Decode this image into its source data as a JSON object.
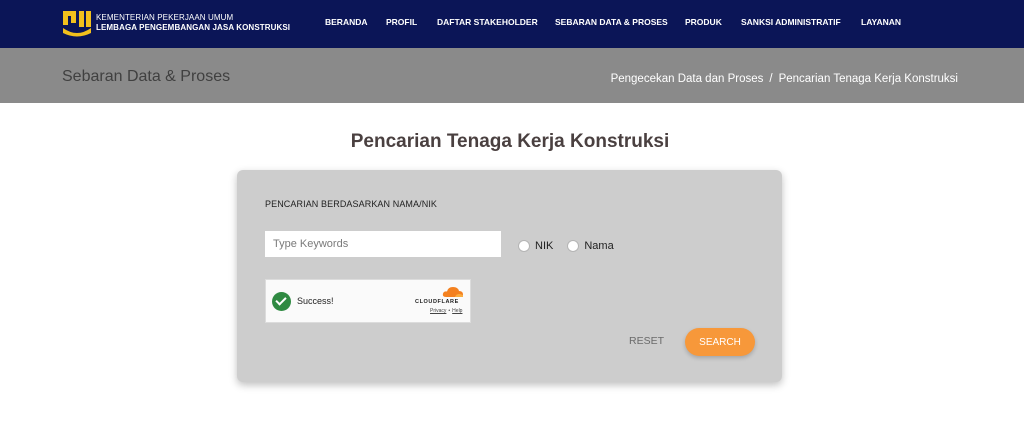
{
  "header": {
    "ministry_line1": "KEMENTERIAN PEKERJAAN UMUM",
    "ministry_line2": "LEMBAGA PENGEMBANGAN JASA KONSTRUKSI",
    "logo_icon": "pupr-logo-icon",
    "nav_bg_color": "#0b1557",
    "menu": [
      {
        "label": "BERANDA"
      },
      {
        "label": "PROFIL"
      },
      {
        "label": "DAFTAR STAKEHOLDER"
      },
      {
        "label": "SEBARAN DATA & PROSES"
      },
      {
        "label": "PRODUK"
      },
      {
        "label": "SANKSI ADMINISTRATIF"
      },
      {
        "label": "LAYANAN"
      }
    ]
  },
  "banner": {
    "title": "Sebaran Data & Proses",
    "breadcrumb": [
      {
        "label": "Pengecekan Data dan Proses"
      },
      {
        "label": "Pencarian Tenaga Kerja Konstruksi"
      }
    ],
    "separator": "/"
  },
  "main": {
    "heading": "Pencarian Tenaga Kerja Konstruksi",
    "form": {
      "section_label": "PENCARIAN BERDASARKAN NAMA/NIK",
      "keyword_placeholder": "Type Keywords",
      "keyword_value": "",
      "options": [
        {
          "label": "NIK",
          "selected": false
        },
        {
          "label": "Nama",
          "selected": false
        }
      ],
      "captcha": {
        "status_text": "Success!",
        "status_icon": "check-circle-icon",
        "provider": "CLOUDFLARE",
        "privacy_link": "Privacy",
        "help_link": "Help",
        "link_separator": "•"
      },
      "reset_label": "RESET",
      "search_label": "SEARCH",
      "accent_color": "#f7983a"
    }
  }
}
